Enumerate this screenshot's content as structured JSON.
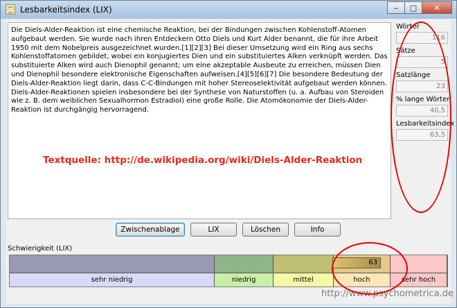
{
  "window": {
    "title": "Lesbarkeitsindex (LIX)",
    "caption_buttons": {
      "minimize": "‒",
      "maximize": "□",
      "close": "✕"
    }
  },
  "text_input": {
    "value": "Die Diels-Alder-Reaktion ist eine chemische Reaktion, bei der Bindungen zwischen Kohlenstoff-Atomen aufgebaut werden. Sie wurde nach ihren Entdeckern Otto Diels und Kurt Alder benannt, die für ihre Arbeit 1950 mit dem Nobelpreis ausgezeichnet wurden.[1][2][3] Bei dieser Umsetzung wird ein Ring aus sechs Kohlenstoffatomen gebildet, wobei ein konjugiertes Dien und ein substituiertes Alken verknüpft werden. Das substituierte Alken wird auch Dienophil genannt; um eine akzeptable Ausbeute zu erreichen, müssen Dien und Dienophil besondere elektronische Eigenschaften aufweisen.[4][5][6][7] Die besondere Bedeutung der Diels-Alder-Reaktion liegt darin, dass C-C-Bindungen mit hoher Stereoselektivität aufgebaut werden können. Diels-Alder-Reaktionen spielen insbesondere bei der Synthese von Naturstoffen (u. a. Aufbau von Steroiden wie z. B. dem weiblichen Sexualhormon Estradiol) eine große Rolle. Die Atomökonomie der Diels-Alder-Reaktion ist durchgängig hervorragend.",
    "source_annotation": "Textquelle: http://de.wikipedia.org/wiki/Diels-Alder-Reaktion"
  },
  "stats": [
    {
      "label": "Wörter",
      "value": "116"
    },
    {
      "label": "Sätze",
      "value": "5"
    },
    {
      "label": "Satzlänge",
      "value": "23"
    },
    {
      "label": "% lange Wörter",
      "value": "40,5"
    },
    {
      "label": "Lesbarkeitsindex",
      "value": "63,5"
    }
  ],
  "buttons": {
    "clipboard": "Zwischenablage",
    "lix": "LIX",
    "clear": "Löschen",
    "info": "Info"
  },
  "difficulty": {
    "label": "Schwierigkeit (LIX)",
    "value": "63",
    "segments": [
      {
        "name": "sehr niedrig",
        "top_color": "#9999b3",
        "bottom_color": "#d9d9f7"
      },
      {
        "name": "niedrig",
        "top_color": "#8fb487",
        "bottom_color": "#c7f0a6"
      },
      {
        "name": "mittel",
        "top_color": "#bfbf73",
        "bottom_color": "#f7f7a8"
      },
      {
        "name": "hoch",
        "top_color": "#e6c98a",
        "bottom_color": "#fde7b8"
      },
      {
        "name": "sehr hoch",
        "top_color": "#fbc7c7",
        "bottom_color": "#fbc7c7"
      }
    ]
  },
  "footer_url": "http://www.psychometrica.de",
  "annotation_color": "#e00000"
}
